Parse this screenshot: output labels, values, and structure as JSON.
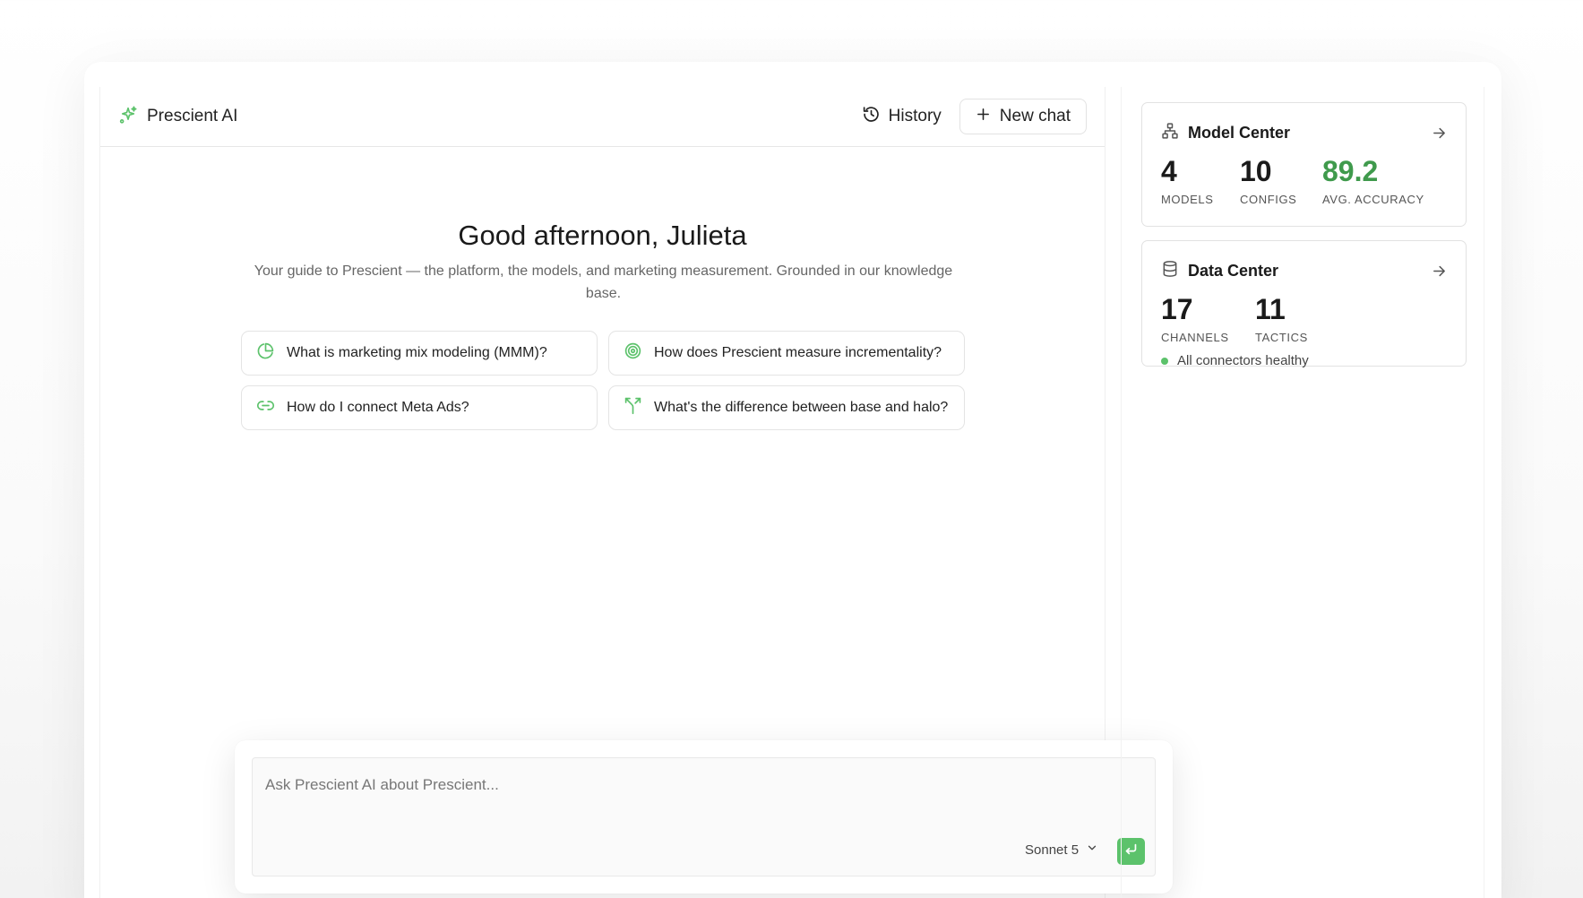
{
  "header": {
    "brand_label": "Prescient AI",
    "history_label": "History",
    "new_chat_label": "New chat"
  },
  "welcome": {
    "greeting": "Good afternoon, Julieta",
    "tagline": "Your guide to Prescient — the platform, the models, and marketing measurement. Grounded in our knowledge base."
  },
  "suggestions": [
    {
      "icon": "pie-chart-icon",
      "text": "What is marketing mix modeling (MMM)?"
    },
    {
      "icon": "target-icon",
      "text": "How does Prescient measure incrementality?"
    },
    {
      "icon": "link-icon",
      "text": "How do I connect Meta Ads?"
    },
    {
      "icon": "split-icon",
      "text": "What's the difference between base and halo?"
    }
  ],
  "composer": {
    "placeholder": "Ask Prescient AI about Prescient...",
    "value": "",
    "model_label": "Sonnet 5"
  },
  "model_center": {
    "title": "Model Center",
    "stats": [
      {
        "value": "4",
        "label": "MODELS"
      },
      {
        "value": "10",
        "label": "CONFIGS"
      },
      {
        "value": "89.2",
        "label": "AVG. ACCURACY"
      }
    ]
  },
  "data_center": {
    "title": "Data Center",
    "stats": [
      {
        "value": "17",
        "label": "CHANNELS"
      },
      {
        "value": "11",
        "label": "TACTICS"
      }
    ],
    "status": "All connectors healthy"
  },
  "colors": {
    "accent": "#5cc26b",
    "accent_dark": "#3f9a4c",
    "border": "#e2e2e2"
  }
}
